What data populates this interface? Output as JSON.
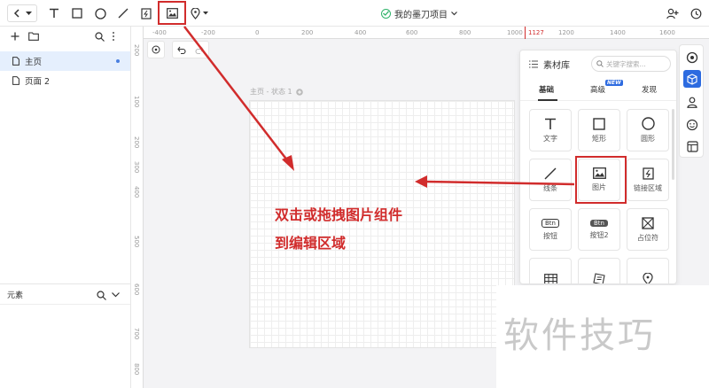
{
  "toolbar": {
    "project_name": "我的墨刀项目"
  },
  "sidebar": {
    "pages": [
      {
        "label": "主页"
      },
      {
        "label": "页面 2"
      }
    ],
    "elements_label": "元素"
  },
  "canvas": {
    "board_label": "主页 - 状态 1",
    "ruler_h": [
      "-400",
      "-200",
      "0",
      "200",
      "400",
      "600",
      "800",
      "1000",
      "1127",
      "1200",
      "1400",
      "1600"
    ],
    "ruler_v": [
      "200",
      "100",
      "200",
      "300",
      "400",
      "500",
      "600",
      "700",
      "800",
      "900"
    ]
  },
  "library": {
    "title": "素材库",
    "search_placeholder": "关键字搜索...",
    "tabs": [
      "基础",
      "高级",
      "发现"
    ],
    "new_badge": "NEW",
    "items": [
      {
        "label": "文字",
        "icon": "text-icon"
      },
      {
        "label": "矩形",
        "icon": "rectangle-icon"
      },
      {
        "label": "圆形",
        "icon": "circle-icon"
      },
      {
        "label": "线条",
        "icon": "line-icon"
      },
      {
        "label": "图片",
        "icon": "image-icon"
      },
      {
        "label": "链接区域",
        "icon": "link-area-icon"
      },
      {
        "label": "按钮",
        "icon": "button-icon"
      },
      {
        "label": "按钮2",
        "icon": "button2-icon"
      },
      {
        "label": "占位符",
        "icon": "placeholder-icon"
      }
    ],
    "btn_text": "Btn"
  },
  "annotation": {
    "line1": "双击或拖拽图片组件",
    "line2": "到编辑区域",
    "color": "#d12c2c"
  },
  "watermark": "软件技巧"
}
